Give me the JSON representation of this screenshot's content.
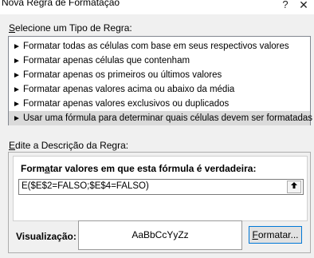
{
  "window": {
    "title": "Nova Regra de Formatação",
    "help": "?",
    "close": "✕"
  },
  "rule_type": {
    "label_u": "S",
    "label_rest": "elecione um Tipo de Regra:",
    "items": [
      {
        "label": "Formatar todas as células com base em seus respectivos valores"
      },
      {
        "label": "Formatar apenas células que contenham"
      },
      {
        "label": "Formatar apenas os primeiros ou últimos valores"
      },
      {
        "label": "Formatar apenas valores acima ou abaixo da média"
      },
      {
        "label": "Formatar apenas valores exclusivos ou duplicados"
      },
      {
        "label": "Usar uma fórmula para determinar quais células devem ser formatadas",
        "selected": true
      }
    ],
    "arrow": "►"
  },
  "description": {
    "label_u": "E",
    "label_rest": "dite a Descrição da Regra:",
    "formula_label_a": "Form",
    "formula_label_u": "a",
    "formula_label_b": "tar valores em que esta fórmula é verdadeira:",
    "formula_value": "E($E$2=FALSO;$E$4=FALSO)",
    "collapse_icon": "🡅",
    "preview_label": "Visualização:",
    "preview_sample": "AaBbCcYyZz",
    "format_button_u": "F",
    "format_button_rest": "ormatar..."
  }
}
